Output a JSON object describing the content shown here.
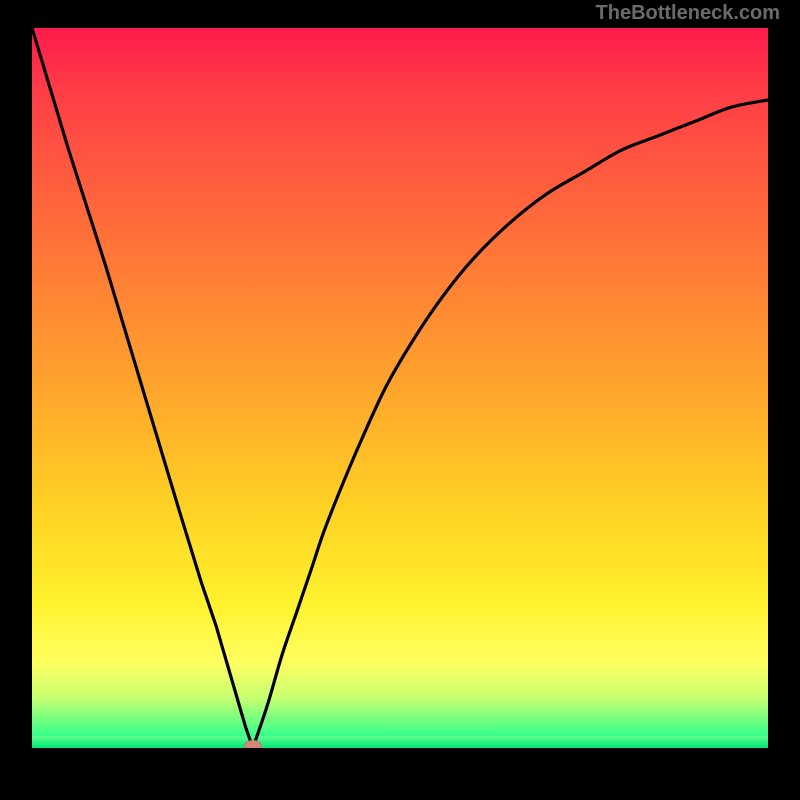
{
  "watermark": "TheBottleneck.com",
  "colors": {
    "background": "#000000",
    "gradient_top": "#ff1a4b",
    "gradient_bottom": "#00e676",
    "curve": "#000000",
    "marker": "#d18a7a",
    "watermark": "#6b6b6b"
  },
  "chart_data": {
    "type": "line",
    "title": "",
    "xlabel": "",
    "ylabel": "",
    "xlim": [
      0,
      100
    ],
    "ylim": [
      0,
      100
    ],
    "series": [
      {
        "name": "left-segment",
        "x": [
          0,
          5,
          10,
          15,
          20,
          23,
          25,
          27,
          29,
          30
        ],
        "values": [
          100,
          83,
          67,
          50,
          33,
          23,
          17,
          10,
          3,
          0
        ]
      },
      {
        "name": "right-segment",
        "x": [
          30,
          32,
          34,
          36,
          38,
          40,
          44,
          48,
          52,
          56,
          60,
          65,
          70,
          75,
          80,
          85,
          90,
          95,
          100
        ],
        "values": [
          0,
          6,
          13,
          19,
          25,
          31,
          41,
          50,
          57,
          63,
          68,
          73,
          77,
          80,
          83,
          85,
          87,
          89,
          90
        ]
      }
    ],
    "annotations": [
      {
        "name": "minimum-marker",
        "x": 30,
        "y": 0
      }
    ],
    "background_gradient": {
      "direction": "vertical",
      "stops": [
        {
          "pos": 0.0,
          "color": "#ff1a4b"
        },
        {
          "pos": 0.5,
          "color": "#ffa52d"
        },
        {
          "pos": 0.8,
          "color": "#fff22e"
        },
        {
          "pos": 1.0,
          "color": "#00e676"
        }
      ]
    }
  }
}
